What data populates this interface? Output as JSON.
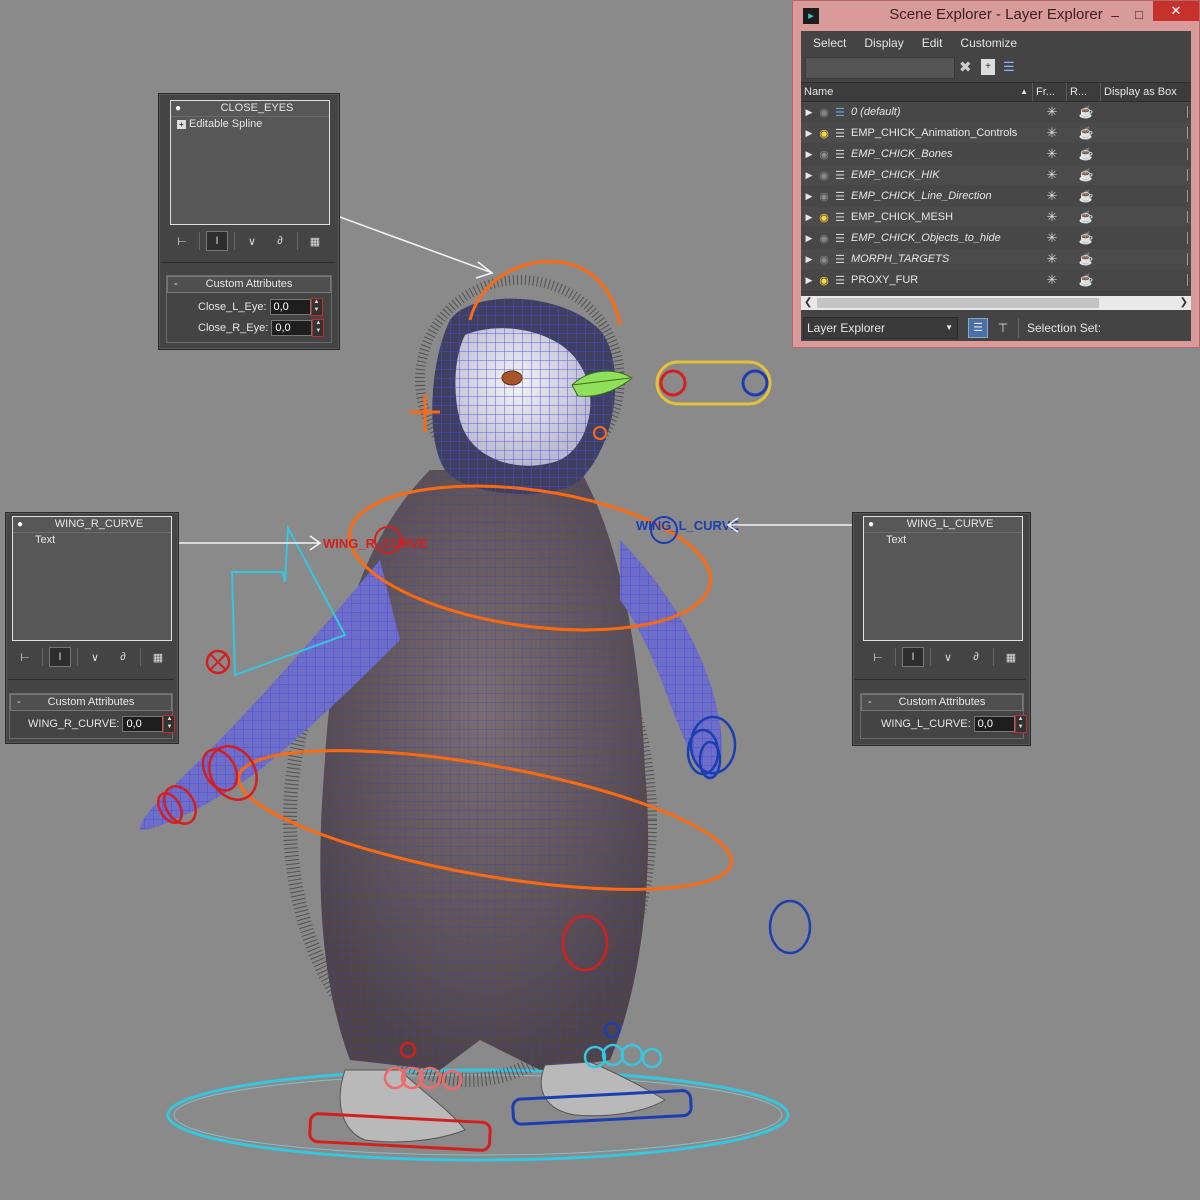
{
  "scene_explorer": {
    "title": "Scene Explorer - Layer Explorer",
    "menu": [
      "Select",
      "Display",
      "Edit",
      "Customize"
    ],
    "columns": [
      "Name",
      "Fr...",
      "R...",
      "Display as Box"
    ],
    "layers": [
      {
        "name": "0 (default)",
        "italic": true,
        "bulb_on": false
      },
      {
        "name": "EMP_CHICK_Animation_Controls",
        "italic": false,
        "bulb_on": true
      },
      {
        "name": "EMP_CHICK_Bones",
        "italic": true,
        "bulb_on": false
      },
      {
        "name": "EMP_CHICK_HIK",
        "italic": true,
        "bulb_on": false
      },
      {
        "name": "EMP_CHICK_Line_Direction",
        "italic": true,
        "bulb_on": false
      },
      {
        "name": "EMP_CHICK_MESH",
        "italic": false,
        "bulb_on": true
      },
      {
        "name": "EMP_CHICK_Objects_to_hide",
        "italic": true,
        "bulb_on": false
      },
      {
        "name": "MORPH_TARGETS",
        "italic": true,
        "bulb_on": false
      },
      {
        "name": "PROXY_FUR",
        "italic": false,
        "bulb_on": true
      }
    ],
    "explorer_dropdown": "Layer Explorer",
    "selection_set_label": "Selection Set:"
  },
  "close_eyes_panel": {
    "object_name": "CLOSE_EYES",
    "modifier": "Editable Spline",
    "rollout_title": "Custom Attributes",
    "attr1_label": "Close_L_Eye:",
    "attr1_value": "0,0",
    "attr2_label": "Close_R_Eye:",
    "attr2_value": "0,0"
  },
  "wing_r_panel": {
    "object_name": "WING_R_CURVE",
    "modifier": "Text",
    "rollout_title": "Custom Attributes",
    "attr_label": "WING_R_CURVE:",
    "attr_value": "0,0"
  },
  "wing_l_panel": {
    "object_name": "WING_L_CURVE",
    "modifier": "Text",
    "rollout_title": "Custom Attributes",
    "attr_label": "WING_L_CURVE:",
    "attr_value": "0,0"
  },
  "viewport_labels": {
    "wing_r": "WING_R_CURVE",
    "wing_l": "WING_L_CURVE"
  },
  "colors": {
    "viewport_bg": "#8a8a8a",
    "control_orange": "#ff6a10",
    "control_red": "#d41f1f",
    "control_blue": "#1b3fb0",
    "control_cyan": "#35c6e0",
    "wireframe": "#4a4ae6",
    "scene_explorer_frame": "#d99a9a"
  }
}
